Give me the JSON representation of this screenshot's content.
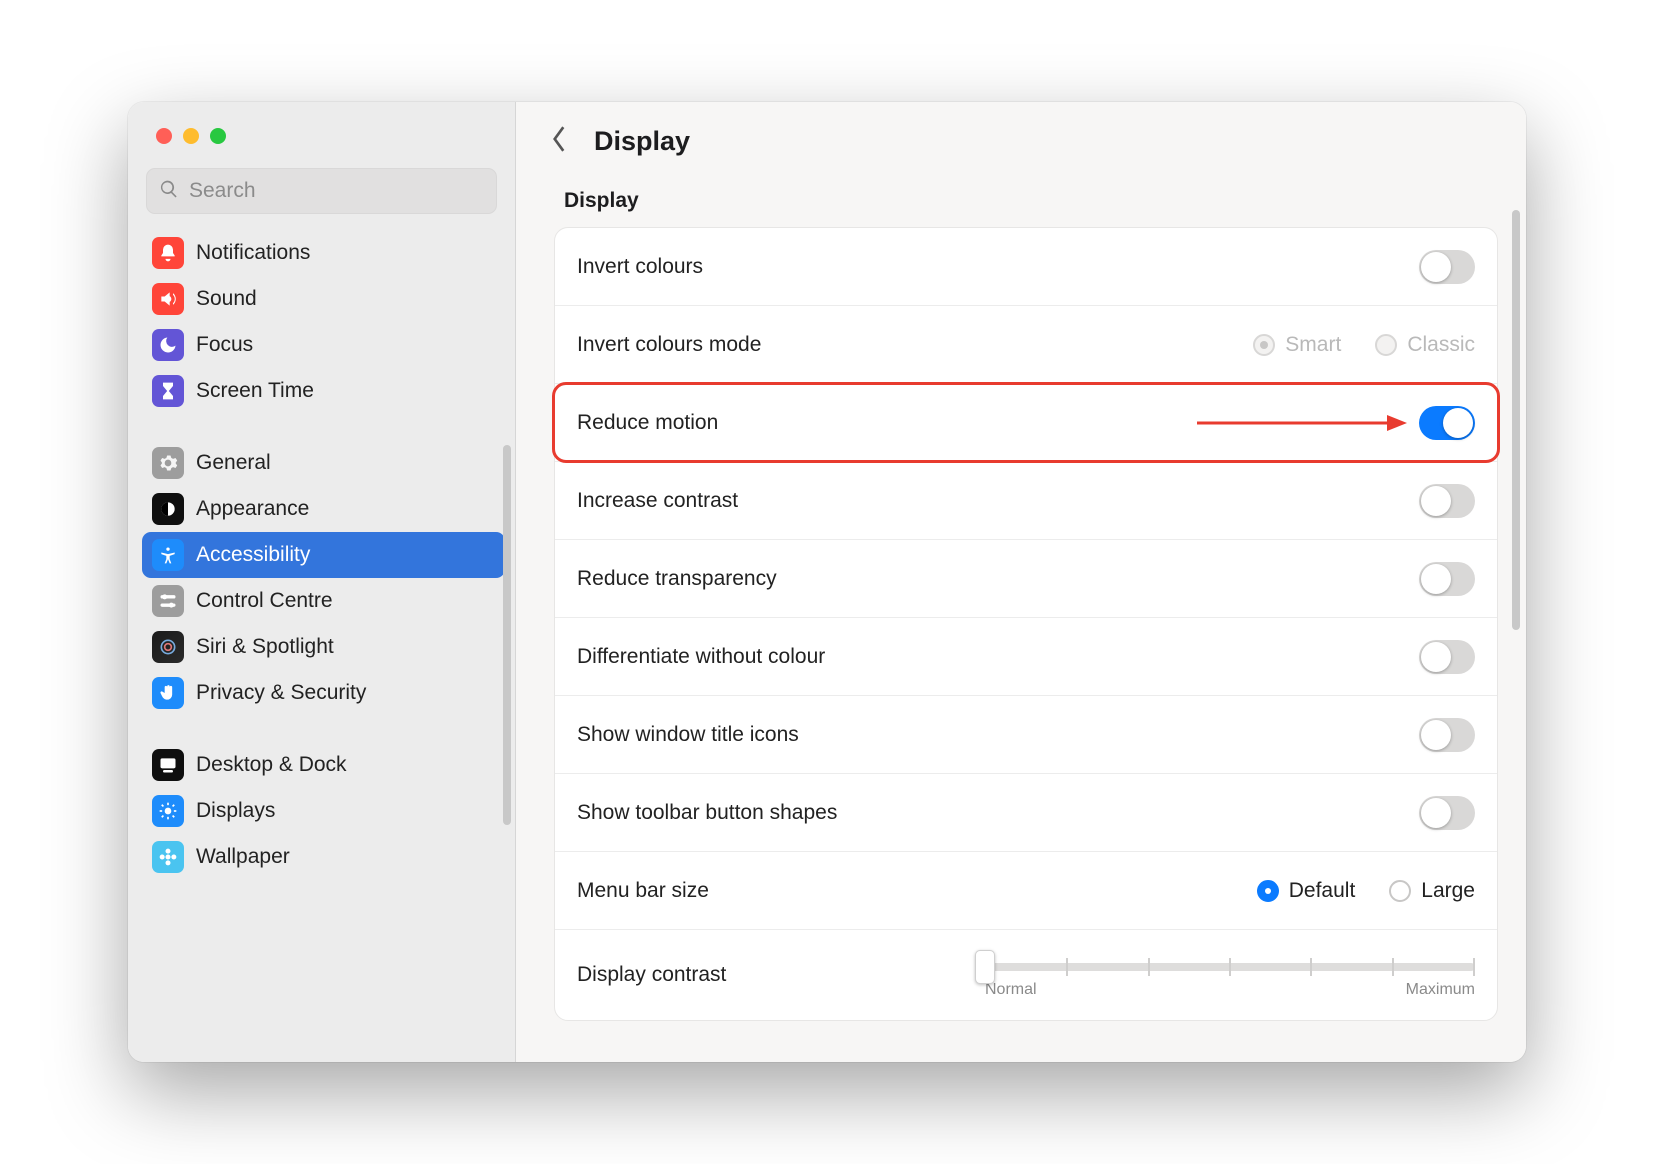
{
  "search": {
    "placeholder": "Search"
  },
  "sidebar": {
    "groups": [
      [
        {
          "label": "Notifications",
          "icon": "notif"
        },
        {
          "label": "Sound",
          "icon": "sound"
        },
        {
          "label": "Focus",
          "icon": "focus"
        },
        {
          "label": "Screen Time",
          "icon": "screen"
        }
      ],
      [
        {
          "label": "General",
          "icon": "general"
        },
        {
          "label": "Appearance",
          "icon": "appear"
        },
        {
          "label": "Accessibility",
          "icon": "access",
          "selected": true
        },
        {
          "label": "Control Centre",
          "icon": "control"
        },
        {
          "label": "Siri & Spotlight",
          "icon": "siri"
        },
        {
          "label": "Privacy & Security",
          "icon": "privacy"
        }
      ],
      [
        {
          "label": "Desktop & Dock",
          "icon": "desktop"
        },
        {
          "label": "Displays",
          "icon": "display"
        },
        {
          "label": "Wallpaper",
          "icon": "wall"
        }
      ]
    ]
  },
  "header": {
    "title": "Display"
  },
  "section": {
    "title": "Display"
  },
  "rows": {
    "invert_colours": {
      "label": "Invert colours",
      "on": false
    },
    "invert_mode": {
      "label": "Invert colours mode",
      "opt1": "Smart",
      "opt2": "Classic",
      "selected": "Smart",
      "disabled": true
    },
    "reduce_motion": {
      "label": "Reduce motion",
      "on": true,
      "highlight": true
    },
    "increase_contrast": {
      "label": "Increase contrast",
      "on": false
    },
    "reduce_transparency": {
      "label": "Reduce transparency",
      "on": false
    },
    "diff_colour": {
      "label": "Differentiate without colour",
      "on": false
    },
    "title_icons": {
      "label": "Show window title icons",
      "on": false
    },
    "toolbar_shapes": {
      "label": "Show toolbar button shapes",
      "on": false
    },
    "menubar_size": {
      "label": "Menu bar size",
      "opt1": "Default",
      "opt2": "Large",
      "selected": "Default"
    },
    "display_contrast": {
      "label": "Display contrast",
      "min_label": "Normal",
      "max_label": "Maximum"
    }
  }
}
